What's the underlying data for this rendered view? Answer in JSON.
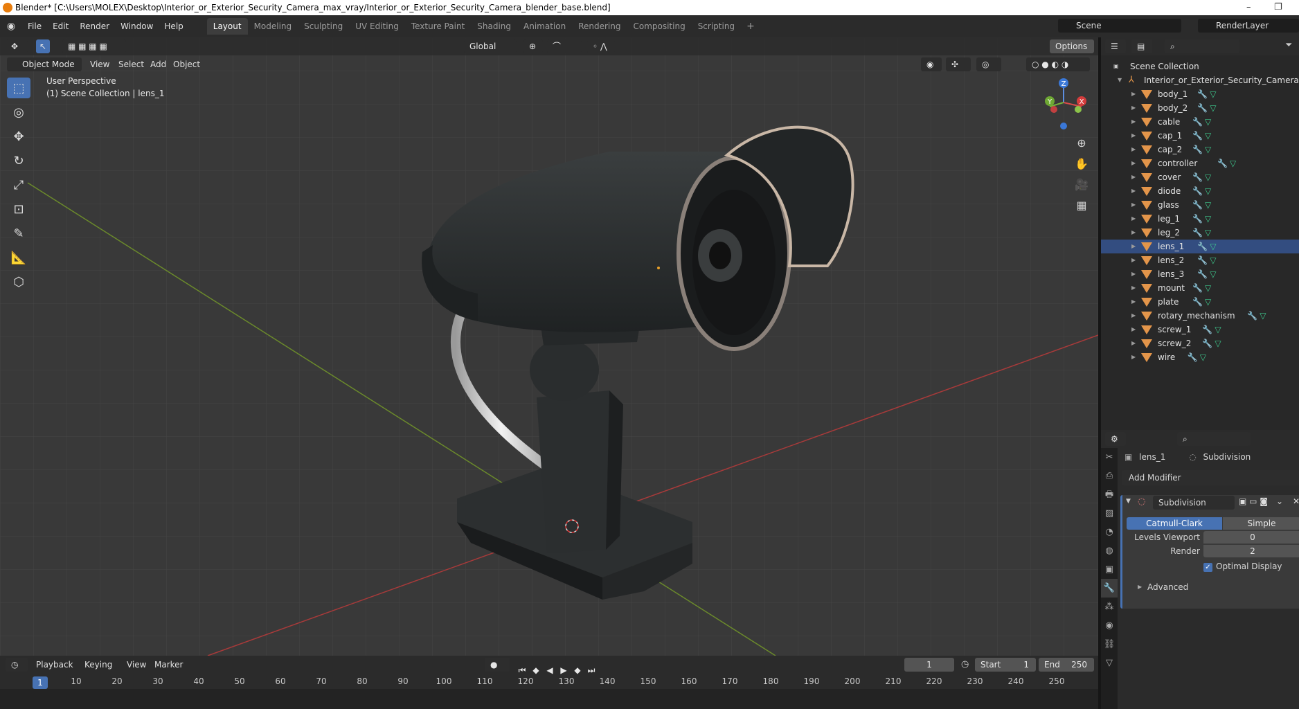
{
  "titlebar": {
    "title": "Blender* [C:\\Users\\MOLEX\\Desktop\\Interior_or_Exterior_Security_Camera_max_vray/Interior_or_Exterior_Security_Camera_blender_base.blend]",
    "minimize": "–",
    "maximize": "❐"
  },
  "menu": {
    "items": [
      "File",
      "Edit",
      "Render",
      "Window",
      "Help"
    ],
    "workspaces": [
      "Layout",
      "Modeling",
      "Sculpting",
      "UV Editing",
      "Texture Paint",
      "Shading",
      "Animation",
      "Rendering",
      "Compositing",
      "Scripting"
    ],
    "add_tab": "+",
    "scene": "Scene",
    "render_layer": "RenderLayer"
  },
  "viewport": {
    "transform_orientation": "Global",
    "options": "Options",
    "mode": "Object Mode",
    "menus": [
      "View",
      "Select",
      "Add",
      "Object"
    ],
    "overlay_title": "User Perspective",
    "overlay_sub": "(1) Scene Collection | lens_1",
    "gizmo": {
      "z": "Z",
      "y": "Y",
      "x": "X"
    }
  },
  "outliner": {
    "root": "Scene Collection",
    "collection": "Interior_or_Exterior_Security_Camera",
    "objects": [
      "body_1",
      "body_2",
      "cable",
      "cap_1",
      "cap_2",
      "controller",
      "cover",
      "diode",
      "glass",
      "leg_1",
      "leg_2",
      "lens_1",
      "lens_2",
      "lens_3",
      "mount",
      "plate",
      "rotary_mechanism",
      "screw_1",
      "screw_2",
      "wire"
    ],
    "selected": "lens_1"
  },
  "properties": {
    "object": "lens_1",
    "modifier_crumb": "Subdivision",
    "add_modifier": "Add Modifier",
    "modifier_name": "Subdivision",
    "algo_catmull": "Catmull-Clark",
    "algo_simple": "Simple",
    "levels_label": "Levels Viewport",
    "levels_value": "0",
    "render_label": "Render",
    "render_value": "2",
    "optimal_label": "Optimal Display",
    "advanced": "Advanced"
  },
  "timeline": {
    "menus": [
      "Playback",
      "Keying",
      "View",
      "Marker"
    ],
    "current_frame": "1",
    "start_label": "Start",
    "start_value": "1",
    "end_label": "End",
    "end_value": "250",
    "ticks": [
      "10",
      "20",
      "30",
      "40",
      "50",
      "60",
      "70",
      "80",
      "90",
      "100",
      "110",
      "120",
      "130",
      "140",
      "150",
      "160",
      "170",
      "180",
      "190",
      "200",
      "210",
      "220",
      "230",
      "240",
      "250"
    ],
    "cursor": "1"
  }
}
